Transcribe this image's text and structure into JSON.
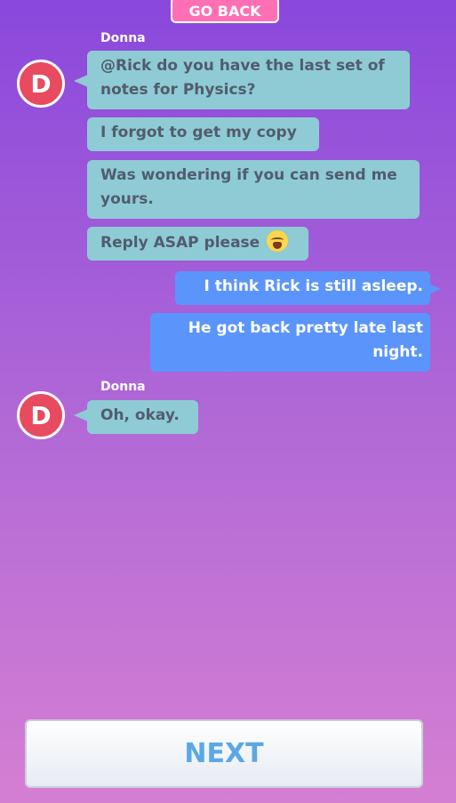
{
  "header": {
    "go_back_label": "GO BACK"
  },
  "messages": [
    {
      "sender": "Donna",
      "avatar_letter": "D",
      "lines": [
        "@Rick do you have the last set of",
        "notes for Physics?"
      ]
    },
    {
      "text": "I forgot to get my copy"
    },
    {
      "lines": [
        "Was wondering if you can send me",
        "yours."
      ]
    },
    {
      "text": "Reply ASAP please",
      "emoji": "crying-face-icon"
    },
    {
      "text": "I think Rick is still asleep."
    },
    {
      "lines": [
        "He got back pretty late last",
        "night."
      ]
    },
    {
      "sender": "Donna",
      "avatar_letter": "D",
      "text": "Oh, okay."
    }
  ],
  "footer": {
    "next_label": "NEXT"
  },
  "colors": {
    "background_top": "#8a48dc",
    "background_bottom": "#d57fd3",
    "incoming_bubble": "#8ecbd5",
    "outgoing_bubble": "#5b95fb",
    "avatar": "#e84a5f",
    "go_back_button": "#ff6fb4",
    "next_text": "#5aa8e8"
  }
}
